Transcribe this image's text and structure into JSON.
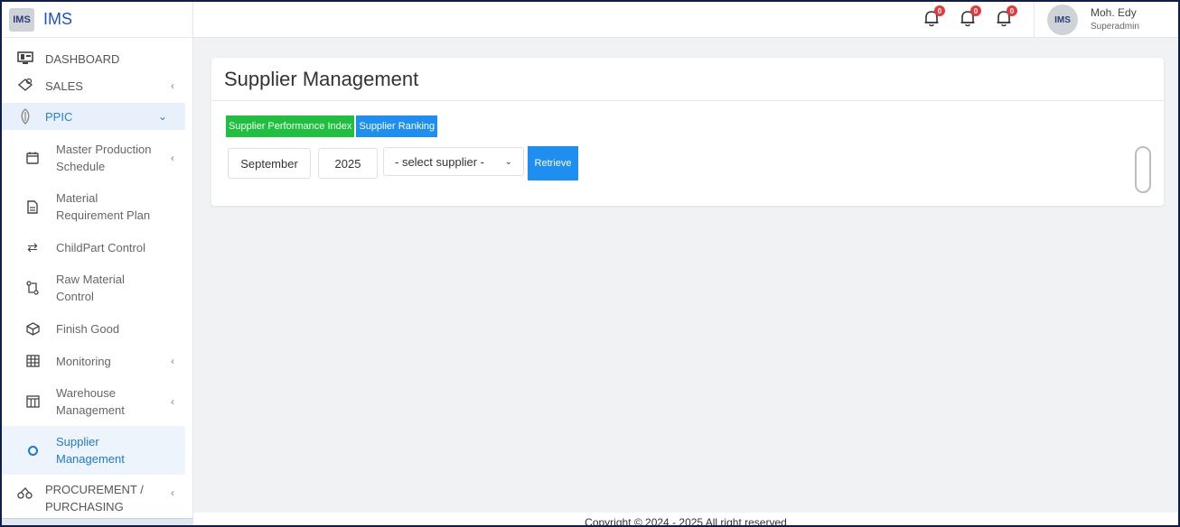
{
  "brand": {
    "logo": "IMS",
    "name": "IMS"
  },
  "sidebar": {
    "top_items": [
      {
        "label": "DASHBOARD",
        "icon": "monitor-icon"
      },
      {
        "label": "SALES",
        "icon": "sales-icon"
      }
    ],
    "group": {
      "label": "PPIC",
      "icon": "ppic-icon"
    },
    "sub_items": [
      {
        "label": "Master Production Schedule"
      },
      {
        "label": "Material Requirement Plan"
      },
      {
        "label": "ChildPart Control"
      },
      {
        "label": "Raw Material Control"
      },
      {
        "label": "Finish Good"
      },
      {
        "label": "Monitoring"
      },
      {
        "label": "Warehouse Management"
      },
      {
        "label": "Supplier Management"
      }
    ],
    "bottom_item": {
      "label": "PROCUREMENT / PURCHASING"
    }
  },
  "header": {
    "notifications": [
      {
        "count": "0"
      },
      {
        "count": "0"
      },
      {
        "count": "0"
      }
    ],
    "user": {
      "avatar": "IMS",
      "name": "Moh. Edy",
      "role": "Superadmin"
    }
  },
  "page": {
    "title": "Supplier Management",
    "tabs": {
      "performance": "Supplier Performance Index",
      "ranking": "Supplier Ranking"
    },
    "filters": {
      "month": "September",
      "year": "2025",
      "supplier_placeholder": "- select supplier -",
      "retrieve_label": "Retrieve"
    }
  },
  "footer": {
    "text": "Copyright © 2024 - 2025 All right reserved"
  },
  "colors": {
    "accent": "#1e8ef0",
    "green": "#1fbf3f",
    "badge": "#e23b3b"
  }
}
